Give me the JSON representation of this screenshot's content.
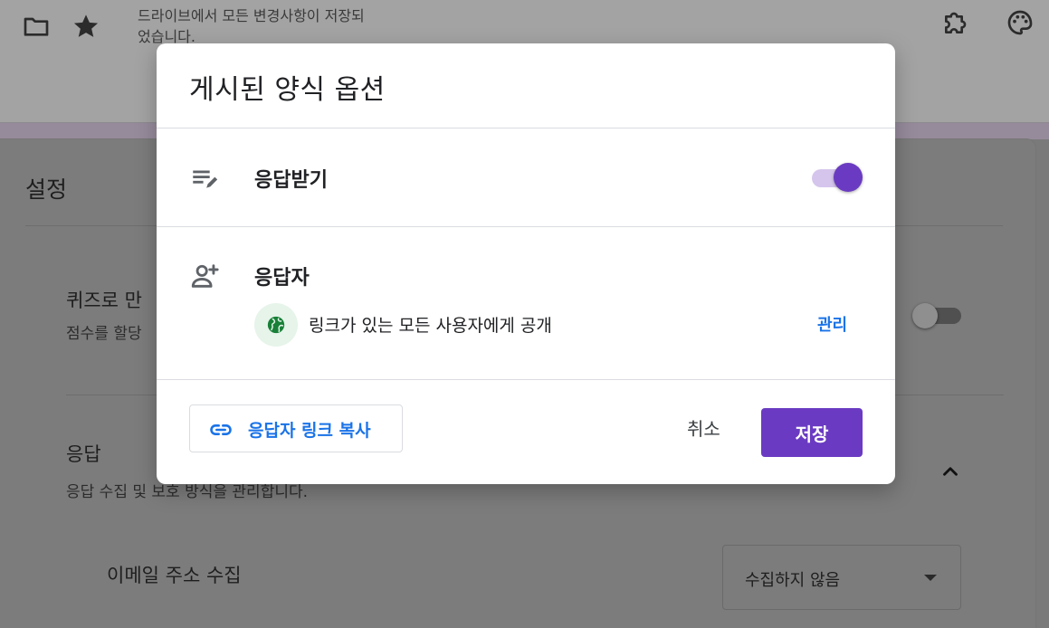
{
  "background": {
    "save_status": "드라이브에서 모든 변경사항이 저장되었습니다.",
    "settings_title": "설정",
    "quiz_title": "퀴즈로 만",
    "quiz_subtitle": "점수를 할당",
    "responses_title": "응답",
    "responses_subtitle": "응답 수집 및 보호 방식을 관리합니다.",
    "email_label": "이메일 주소 수집",
    "email_select_value": "수집하지 않음",
    "icons": [
      "folder-icon",
      "star-icon",
      "addon-icon",
      "palette-icon",
      "chevron-up-icon"
    ]
  },
  "dialog": {
    "title": "게시된 양식 옵션",
    "accept_responses": {
      "label": "응답받기",
      "icon": "edit-list-icon",
      "enabled": true
    },
    "responders": {
      "label": "응답자",
      "icon": "add-person-icon",
      "audience_text": "링크가 있는 모든 사용자에게 공개",
      "audience_icon": "globe-icon",
      "manage_label": "관리"
    },
    "copy_link_label": "응답자 링크 복사",
    "cancel_label": "취소",
    "save_label": "저장"
  },
  "colors": {
    "accent": "#6a3bc2",
    "link": "#1a73e8",
    "globe": "#188038"
  }
}
